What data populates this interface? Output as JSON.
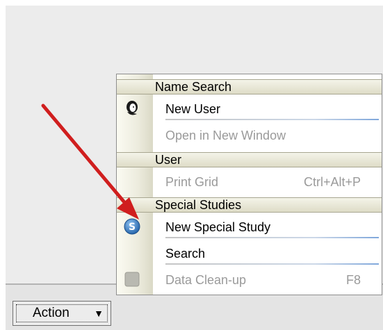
{
  "menu": {
    "sections": [
      {
        "title": "Name Search",
        "items": [
          {
            "label": "New User",
            "icon": "user-head-icon",
            "enabled": true
          },
          {
            "label": "Open in New Window",
            "enabled": false
          }
        ]
      },
      {
        "title": "User",
        "items": [
          {
            "label": "Print Grid",
            "shortcut": "Ctrl+Alt+P",
            "enabled": false
          }
        ]
      },
      {
        "title": "Special Studies",
        "items": [
          {
            "label": "New Special Study",
            "icon": "special-study-s-icon",
            "enabled": true
          },
          {
            "label": "Search",
            "enabled": true
          },
          {
            "label": "Data Clean-up",
            "shortcut": "F8",
            "icon": "data-cleanup-icon",
            "enabled": false
          }
        ]
      }
    ]
  },
  "action_button": {
    "label": "Action",
    "arrow": "▼"
  },
  "colors": {
    "annotation_arrow": "#d01e1e",
    "study_icon": "#2f78c4"
  }
}
